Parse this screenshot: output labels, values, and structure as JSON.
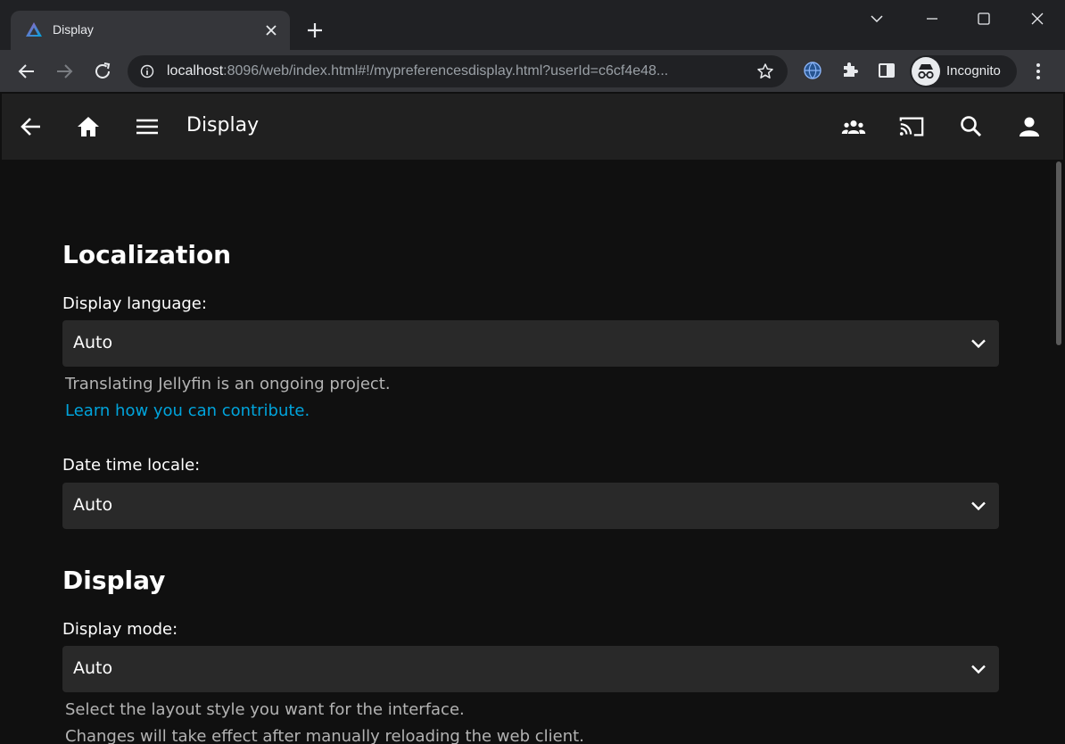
{
  "browser": {
    "tab_title": "Display",
    "url_host": "localhost",
    "url_rest": ":8096/web/index.html#!/mypreferencesdisplay.html?userId=c6cf4e48...",
    "profile_label": "Incognito"
  },
  "app_header": {
    "title": "Display"
  },
  "localization": {
    "section_title": "Localization",
    "display_language": {
      "label": "Display language:",
      "value": "Auto",
      "help": "Translating Jellyfin is an ongoing project.",
      "link": "Learn how you can contribute."
    },
    "date_time_locale": {
      "label": "Date time locale:",
      "value": "Auto"
    }
  },
  "display": {
    "section_title": "Display",
    "display_mode": {
      "label": "Display mode:",
      "value": "Auto",
      "help_line1": "Select the layout style you want for the interface.",
      "help_line2": "Changes will take effect after manually reloading the web client."
    }
  },
  "colors": {
    "accent": "#00a4dc",
    "background": "#101010",
    "header": "#202020",
    "select_bg": "#292929"
  }
}
